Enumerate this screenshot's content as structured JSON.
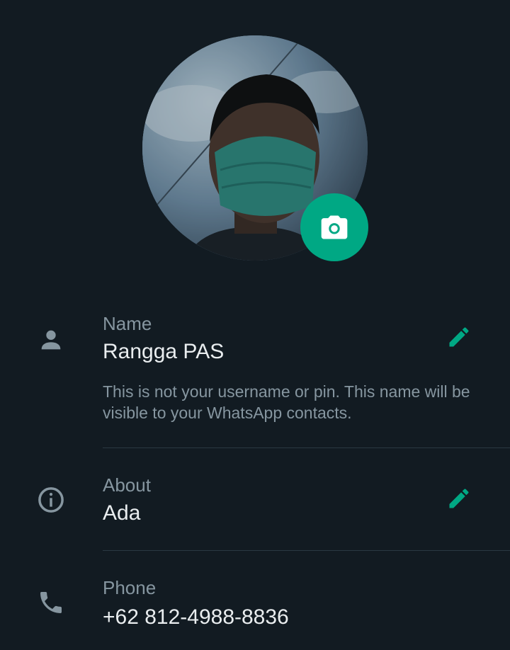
{
  "profile": {
    "photo_alt": "profile photo",
    "camera_icon": "camera-icon"
  },
  "name_section": {
    "label": "Name",
    "value": "Rangga PAS",
    "hint": "This is not your username or pin. This name will be visible to your WhatsApp contacts.",
    "icon": "person-icon",
    "edit_icon": "pencil-icon"
  },
  "about_section": {
    "label": "About",
    "value": "Ada",
    "icon": "info-icon",
    "edit_icon": "pencil-icon"
  },
  "phone_section": {
    "label": "Phone",
    "value": "+62 812-4988-8836",
    "icon": "phone-icon"
  },
  "colors": {
    "background": "#121b22",
    "accent": "#00a884",
    "primary_text": "#e9edef",
    "secondary_text": "#8696a0",
    "divider": "#2a3942"
  }
}
